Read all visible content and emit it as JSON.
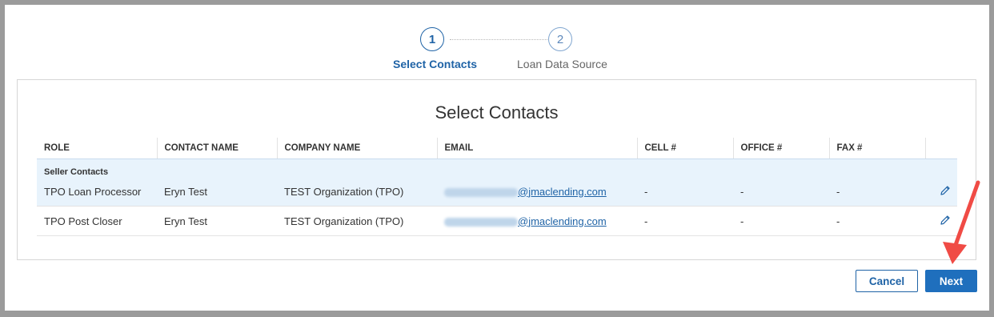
{
  "stepper": {
    "steps": [
      {
        "number": "1",
        "label": "Select Contacts",
        "state": "active"
      },
      {
        "number": "2",
        "label": "Loan Data Source",
        "state": "inactive"
      }
    ]
  },
  "panel": {
    "title": "Select Contacts"
  },
  "table": {
    "columns": [
      "ROLE",
      "CONTACT NAME",
      "COMPANY NAME",
      "EMAIL",
      "CELL #",
      "OFFICE #",
      "FAX #",
      ""
    ],
    "group_label": "Seller Contacts",
    "rows": [
      {
        "role": "TPO Loan Processor",
        "contact_name": "Eryn Test",
        "company_name": "TEST Organization (TPO)",
        "email_domain": "@jmaclending.com",
        "cell": "-",
        "office": "-",
        "fax": "-"
      },
      {
        "role": "TPO Post Closer",
        "contact_name": "Eryn Test",
        "company_name": "TEST Organization (TPO)",
        "email_domain": "@jmaclending.com",
        "cell": "-",
        "office": "-",
        "fax": "-"
      }
    ]
  },
  "actions": {
    "cancel_label": "Cancel",
    "next_label": "Next"
  },
  "colors": {
    "accent": "#1f63a6",
    "primary_button": "#1f6fbd",
    "row_highlight": "#e8f3fc",
    "annotation_arrow": "#f04b45"
  },
  "icons": [
    "pencil-icon",
    "arrow-annotation"
  ]
}
